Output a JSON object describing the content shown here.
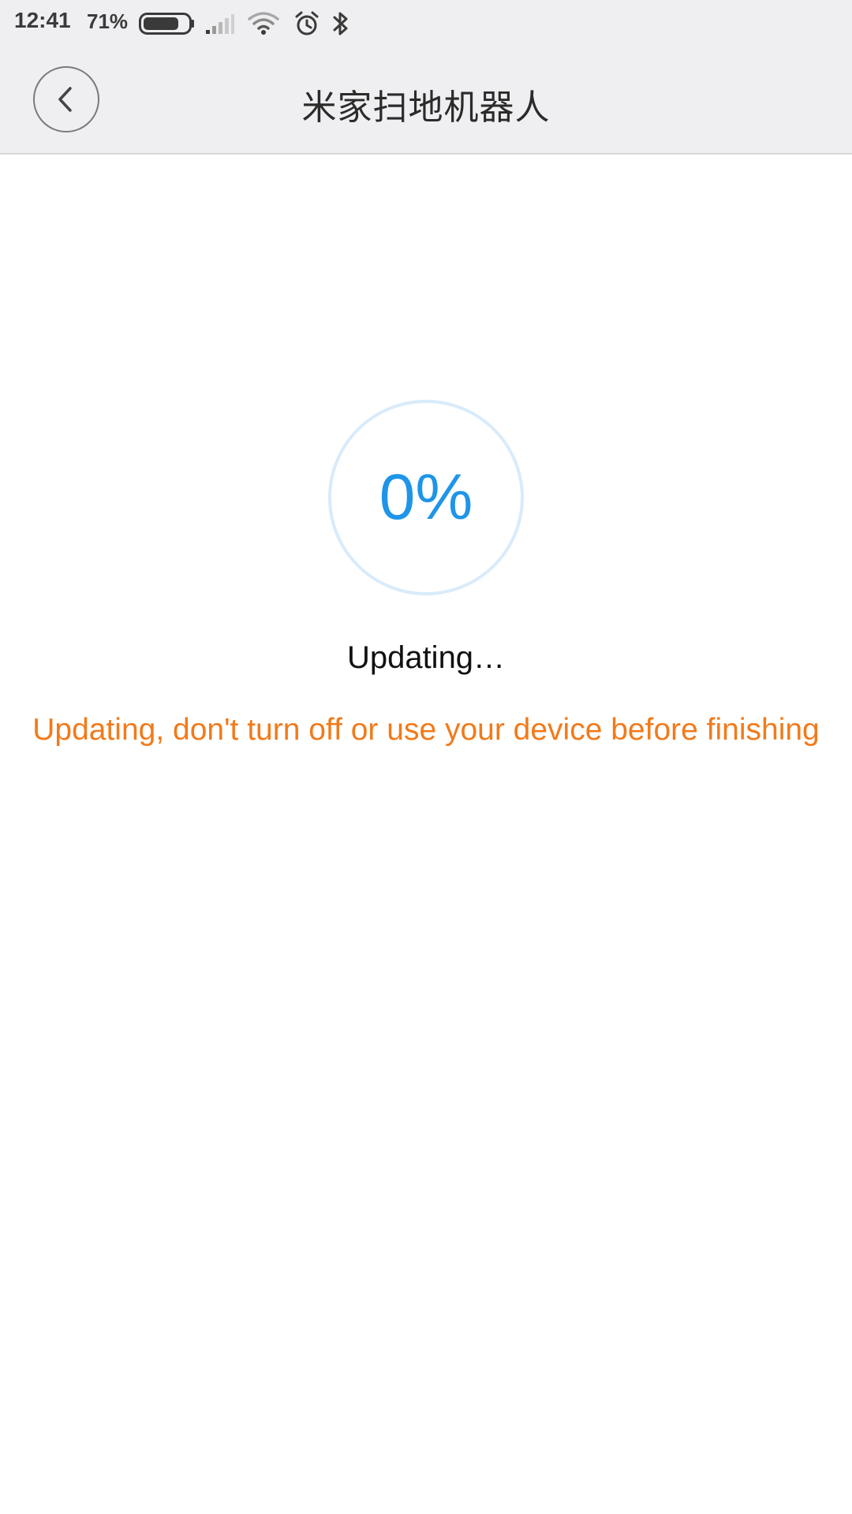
{
  "status_bar": {
    "time": "12:41",
    "battery_percent": "71%",
    "icons": [
      "battery-icon",
      "signal-icon",
      "wifi-icon",
      "alarm-icon",
      "bluetooth-icon"
    ]
  },
  "nav": {
    "title": "米家扫地机器人",
    "back_icon": "chevron-left-icon"
  },
  "progress": {
    "percent_text": "0%",
    "value": 0,
    "accent_color": "#1e95e8",
    "ring_color": "#d8ebfb"
  },
  "status_label": "Updating…",
  "warning": {
    "text": "Updating, don't turn off or use your device before finishing",
    "color": "#f27a1a"
  }
}
